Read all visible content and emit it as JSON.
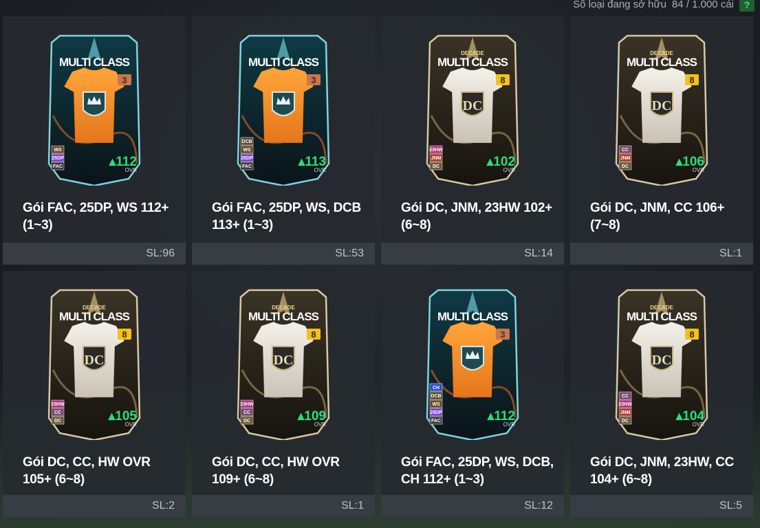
{
  "header": {
    "owned_label": "Số loại đang sở hữu",
    "owned_count": "84 / 1.000 cái",
    "help_icon": "?"
  },
  "colors": {
    "ovr_green": "#27e07a",
    "help_bg": "#1f5f33",
    "tile_bg": "#262a30",
    "footer_bg": "#3a3e45"
  },
  "packs": [
    {
      "title": "Gói FAC, 25DP, WS 112+ (1~3)",
      "qty": "SL:96",
      "card": {
        "style": "multiclass",
        "top_label": "",
        "main_label": "MULTI CLASS",
        "badge": "3",
        "ovr": "112",
        "ovr_label": "OVR",
        "chips": [
          "WS",
          "25DP",
          "FAC"
        ]
      }
    },
    {
      "title": "Gói FAC, 25DP, WS, DCB 113+ (1~3)",
      "qty": "SL:53",
      "card": {
        "style": "multiclass",
        "top_label": "",
        "main_label": "MULTI CLASS",
        "badge": "3",
        "ovr": "113",
        "ovr_label": "OVR",
        "chips": [
          "DCB",
          "WS",
          "25DP",
          "FAC"
        ]
      }
    },
    {
      "title": "Gói DC, JNM, 23HW 102+ (6~8)",
      "qty": "SL:14",
      "card": {
        "style": "decade",
        "top_label": "DECADE",
        "main_label": "MULTI CLASS",
        "badge": "8",
        "ovr": "102",
        "ovr_label": "OVR",
        "chips": [
          "23HW",
          "JNM",
          "DC"
        ]
      }
    },
    {
      "title": "Gói DC, JNM, CC 106+ (7~8)",
      "qty": "SL:1",
      "card": {
        "style": "decade",
        "top_label": "DECADE",
        "main_label": "MULTI CLASS",
        "badge": "8",
        "ovr": "106",
        "ovr_label": "OVR",
        "chips": [
          "CC",
          "JNM",
          "DC"
        ]
      }
    },
    {
      "title": "Gói DC, CC, HW OVR 105+ (6~8)",
      "qty": "SL:2",
      "card": {
        "style": "decade",
        "top_label": "DECADE",
        "main_label": "MULTI CLASS",
        "badge": "8",
        "ovr": "105",
        "ovr_label": "OVR",
        "chips": [
          "23HW",
          "CC",
          "DC"
        ]
      }
    },
    {
      "title": "Gói DC, CC, HW OVR 109+ (6~8)",
      "qty": "SL:1",
      "card": {
        "style": "decade",
        "top_label": "DECADE",
        "main_label": "MULTI CLASS",
        "badge": "8",
        "ovr": "109",
        "ovr_label": "OVR",
        "chips": [
          "23HW",
          "CC",
          "DC"
        ]
      }
    },
    {
      "title": "Gói FAC, 25DP, WS, DCB, CH 112+ (1~3)",
      "qty": "SL:12",
      "card": {
        "style": "multiclass",
        "top_label": "",
        "main_label": "MULTI CLASS",
        "badge": "3",
        "ovr": "112",
        "ovr_label": "OVR",
        "chips": [
          "CH",
          "DCB",
          "WS",
          "25DP",
          "FAC"
        ]
      }
    },
    {
      "title": "Gói DC, JNM, 23HW, CC 104+ (6~8)",
      "qty": "SL:5",
      "card": {
        "style": "decade",
        "top_label": "DECADE",
        "main_label": "MULTI CLASS",
        "badge": "8",
        "ovr": "104",
        "ovr_label": "OVR",
        "chips": [
          "CC",
          "23HW",
          "JNM",
          "DC"
        ]
      }
    }
  ]
}
